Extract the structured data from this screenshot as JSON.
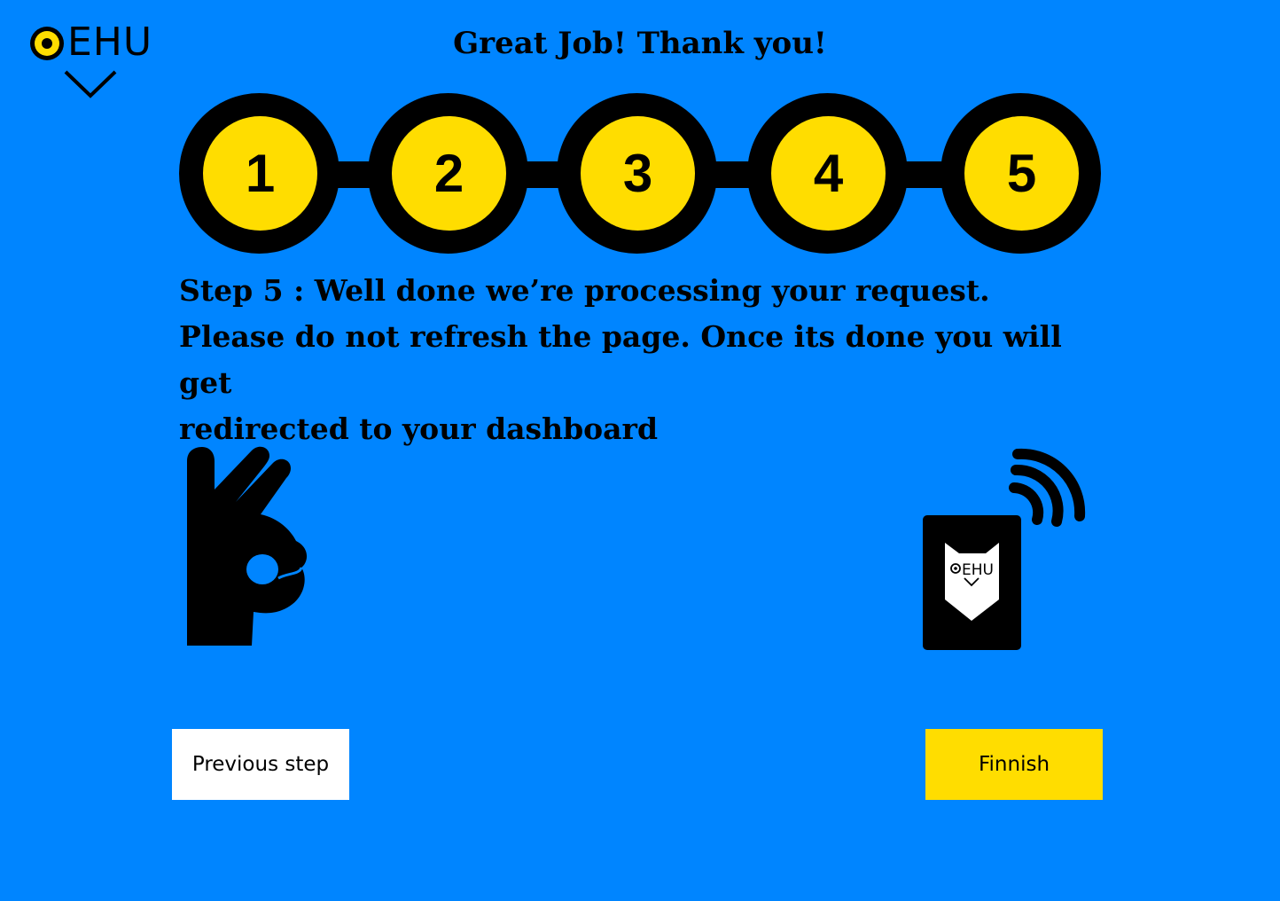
{
  "logo": {
    "text": "EHU",
    "icon": "eye-logo-icon"
  },
  "header": {
    "title": "Great Job! Thank you!"
  },
  "stepper": {
    "steps": [
      {
        "label": "1"
      },
      {
        "label": "2"
      },
      {
        "label": "3"
      },
      {
        "label": "4"
      },
      {
        "label": "5"
      }
    ],
    "current_step": 5,
    "colors": {
      "ring": "#000000",
      "fill": "#ffdd00"
    }
  },
  "message": {
    "line1": "Step 5 : Well done we’re processing your request.",
    "line2": "Please do not refresh the page. Once its done you will get",
    "line3": "redirected to your dashboard"
  },
  "illustrations": {
    "left": "ok-hand-icon",
    "right": "nfc-card-icon",
    "card_logo_text": "EHU"
  },
  "buttons": {
    "previous_label": "Previous step",
    "finish_label": "Finnish"
  },
  "colors": {
    "background": "#0085ff",
    "accent": "#ffdd00",
    "ink": "#000000",
    "button_secondary": "#ffffff"
  }
}
